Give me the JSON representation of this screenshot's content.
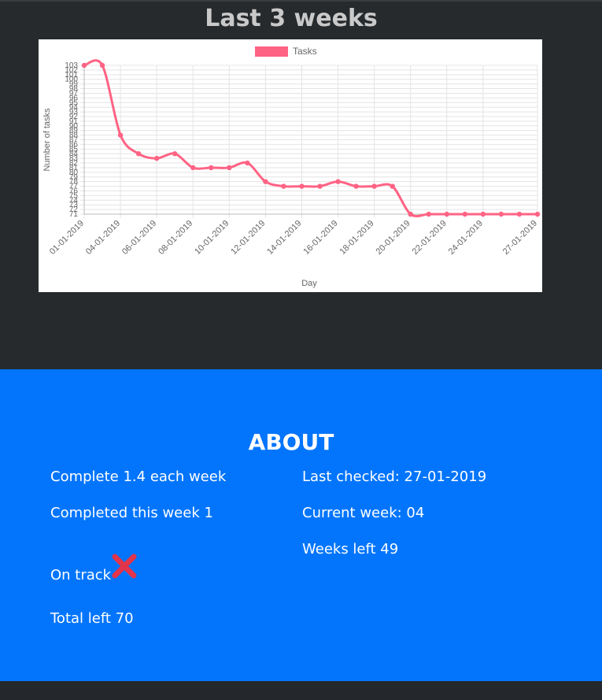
{
  "page": {
    "title": "Last 3 weeks"
  },
  "chart_data": {
    "type": "line",
    "legend": {
      "label": "Tasks",
      "position": "top",
      "color": "#ff6384"
    },
    "xlabel": "Day",
    "ylabel": "Number of tasks",
    "ylim": [
      71,
      103
    ],
    "y_ticks": [
      71,
      72,
      73,
      74,
      75,
      76,
      77,
      78,
      79,
      80,
      81,
      82,
      83,
      84,
      85,
      86,
      87,
      88,
      89,
      90,
      91,
      92,
      93,
      94,
      95,
      96,
      97,
      98,
      99,
      100,
      101,
      102,
      103
    ],
    "x_tick_labels": [
      "01-01-2019",
      "04-01-2019",
      "06-01-2019",
      "08-01-2019",
      "10-01-2019",
      "12-01-2019",
      "14-01-2019",
      "16-01-2019",
      "18-01-2019",
      "20-01-2019",
      "22-01-2019",
      "24-01-2019",
      "27-01-2019"
    ],
    "x_tick_positions": [
      0,
      2,
      4,
      6,
      8,
      10,
      12,
      14,
      16,
      18,
      20,
      22,
      25
    ],
    "grid": true,
    "series": [
      {
        "name": "Tasks",
        "values": [
          103,
          103,
          88,
          84,
          83,
          84,
          81,
          81,
          81,
          82,
          78,
          77,
          77,
          77,
          78,
          77,
          77,
          77,
          71,
          71,
          71,
          71,
          71,
          71,
          71,
          71
        ]
      }
    ]
  },
  "about": {
    "title": "ABOUT",
    "complete_per_week": "Complete 1.4 each week",
    "last_checked": "Last checked: 27-01-2019",
    "completed_this_week": "Completed this week 1",
    "current_week": "Current week: 04",
    "weeks_left": "Weeks left 49",
    "on_track": "On track",
    "on_track_icon": "cross-icon",
    "on_track_icon_color": "#e2344b",
    "total_left": "Total left 70"
  },
  "colors": {
    "about_bg": "#0275fc",
    "page_bg": "#262a2d"
  }
}
